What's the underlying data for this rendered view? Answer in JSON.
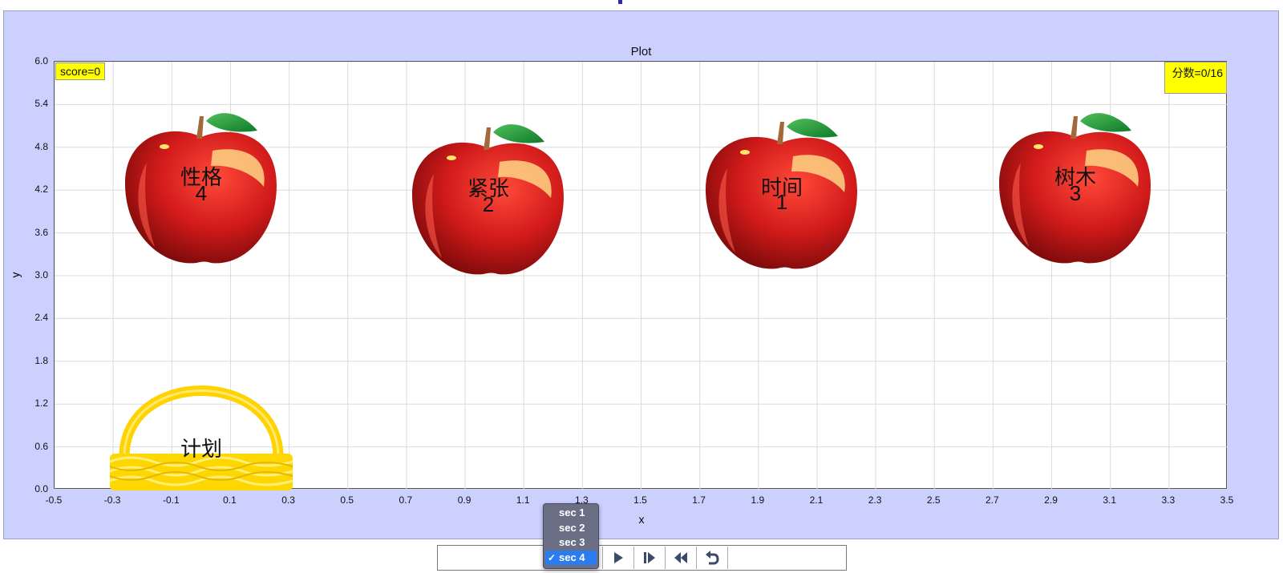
{
  "plot": {
    "title": "Plot",
    "xlabel": "x",
    "ylabel": "y",
    "x_ticks": [
      "-0.5",
      "-0.3",
      "-0.1",
      "0.1",
      "0.3",
      "0.5",
      "0.7",
      "0.9",
      "1.1",
      "1.3",
      "1.5",
      "1.7",
      "1.9",
      "2.1",
      "2.3",
      "2.5",
      "2.7",
      "2.9",
      "3.1",
      "3.3",
      "3.5"
    ],
    "y_ticks": [
      "6.0",
      "5.4",
      "4.8",
      "4.2",
      "3.6",
      "3.0",
      "2.4",
      "1.8",
      "1.2",
      "0.6",
      "0.0"
    ],
    "xlim": [
      -0.5,
      3.5
    ],
    "ylim": [
      0,
      6
    ],
    "grid": true
  },
  "score_left": "score=0",
  "score_right": "分数=0/16",
  "apples": [
    {
      "word": "性格",
      "number": "4"
    },
    {
      "word": "紧张",
      "number": "2"
    },
    {
      "word": "时间",
      "number": "1"
    },
    {
      "word": "树木",
      "number": "3"
    }
  ],
  "basket": {
    "label": "计划"
  },
  "section_menu": {
    "items": [
      "sec 1",
      "sec 2",
      "sec 3",
      "sec 4"
    ],
    "selected": "sec 4"
  },
  "controls": {
    "play": "play-icon",
    "step": "step-forward-icon",
    "rewind": "rewind-icon",
    "reset": "reset-icon"
  },
  "colors": {
    "panel_bg": "#ccd0ff",
    "score_bg": "#ffff00",
    "apple_red": "#d11a1a",
    "basket_yellow": "#ffd700",
    "menu_bg": "#6a6f86",
    "menu_selected": "#2b7cf0"
  }
}
